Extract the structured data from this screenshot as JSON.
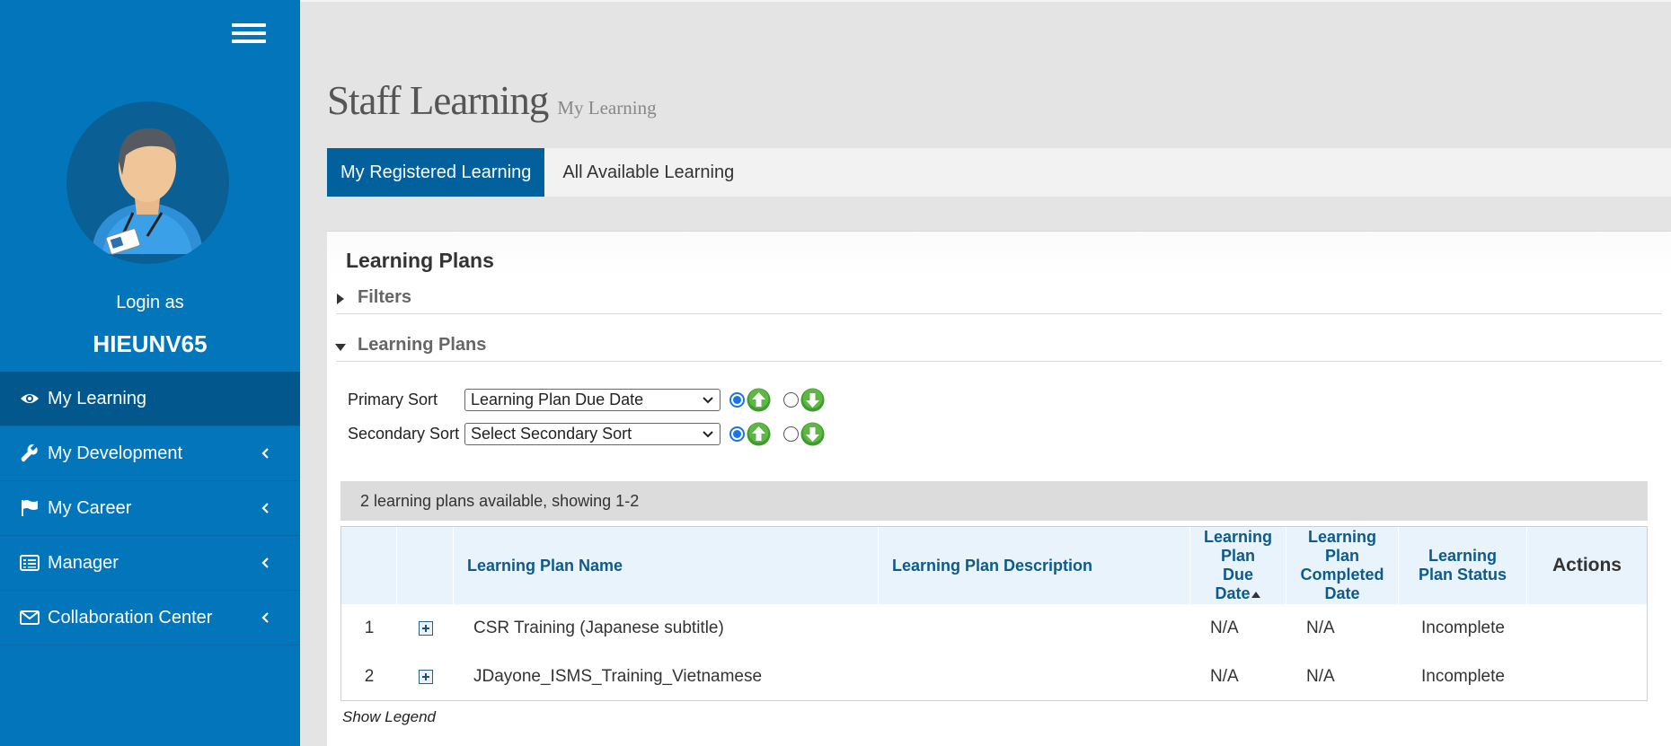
{
  "sidebar": {
    "login_label": "Login as",
    "username": "HIEUNV65",
    "items": [
      {
        "label": "My Learning",
        "icon": "eye-icon"
      },
      {
        "label": "My Development",
        "icon": "wrench-icon"
      },
      {
        "label": "My Career",
        "icon": "flag-icon"
      },
      {
        "label": "Manager",
        "icon": "list-icon"
      },
      {
        "label": "Collaboration Center",
        "icon": "envelope-icon"
      }
    ]
  },
  "header": {
    "title": "Staff Learning",
    "subtitle": "My Learning"
  },
  "tabs": [
    {
      "label": "My Registered Learning",
      "active": true
    },
    {
      "label": "All Available Learning",
      "active": false
    }
  ],
  "panel": {
    "title": "Learning Plans",
    "filters_label": "Filters",
    "section_label": "Learning Plans",
    "primary_sort": {
      "label": "Primary Sort",
      "value": "Learning Plan Due Date",
      "ascending": true
    },
    "secondary_sort": {
      "label": "Secondary Sort",
      "value": "Select Secondary Sort",
      "ascending": true
    },
    "count_text": "2 learning plans available, showing 1-2",
    "columns": {
      "name": "Learning Plan Name",
      "description": "Learning Plan Description",
      "due_date": [
        "Learning",
        "Plan",
        "Due",
        "Date"
      ],
      "completed_date": [
        "Learning",
        "Plan",
        "Completed",
        "Date"
      ],
      "status": [
        "Learning",
        "Plan Status"
      ],
      "actions": "Actions"
    },
    "rows": [
      {
        "index": "1",
        "name": "CSR Training (Japanese subtitle)",
        "description": "",
        "due_date": "N/A",
        "completed_date": "N/A",
        "status": "Incomplete"
      },
      {
        "index": "2",
        "name": "JDayone_ISMS_Training_Vietnamese",
        "description": "",
        "due_date": "N/A",
        "completed_date": "N/A",
        "status": "Incomplete"
      }
    ],
    "legend_link": "Show Legend"
  },
  "colors": {
    "sidebar_bg": "#0376bb",
    "sidebar_active": "#02578d",
    "tab_active": "#02619c",
    "header_text": "#0e5a8a",
    "arrow_green": "#3f9a2f"
  }
}
